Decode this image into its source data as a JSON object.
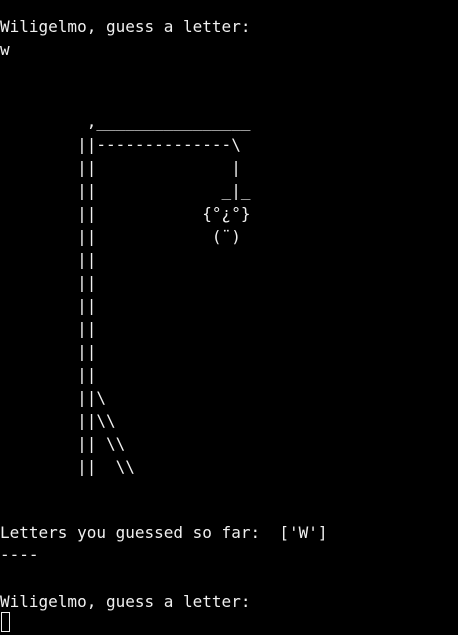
{
  "session": {
    "prompt_1": "Wiligelmo, guess a letter:",
    "input_1": "w",
    "hangman_art": "         ,________________\n        ||--------------\\\n        ||              |\n        ||             _|_\n        ||           {°¿°}\n        ||            (¨)\n        ||\n        ||\n        ||\n        ||\n        ||\n        ||\n        ||\\\n        ||\\\\\n        || \\\\\n        ||  \\\\",
    "guessed_label": "Letters you guessed so far:  ['W']",
    "separator": "----",
    "prompt_2": "Wiligelmo, guess a letter:"
  },
  "colors": {
    "background": "#000000",
    "foreground": "#f0f0f0"
  }
}
